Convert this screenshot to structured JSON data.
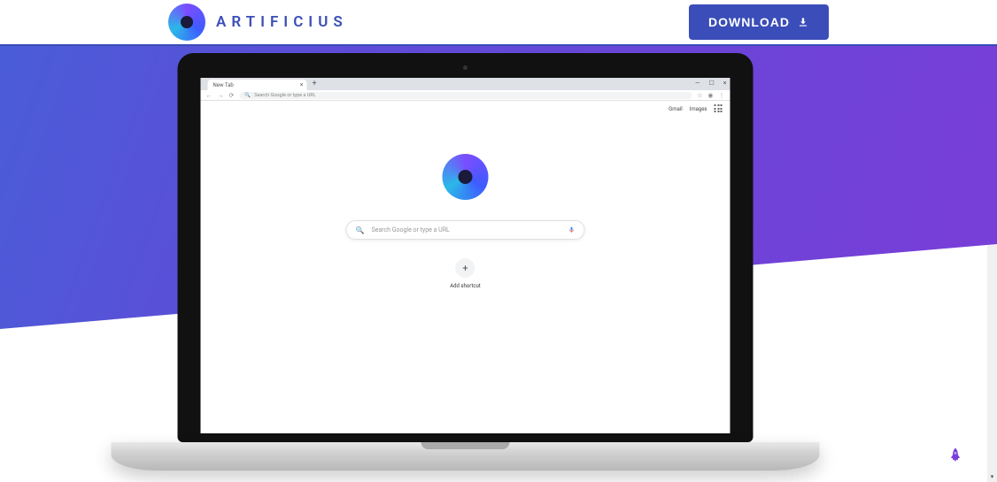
{
  "header": {
    "brand": "ARTIFICIUS",
    "download_label": "DOWNLOAD"
  },
  "browser": {
    "tab_title": "New Tab",
    "url_placeholder": "Search Google or type a URL",
    "links": {
      "gmail": "Gmail",
      "images": "Images"
    },
    "search_placeholder": "Search Google or type a URL",
    "shortcut_label": "Add shortcut"
  }
}
